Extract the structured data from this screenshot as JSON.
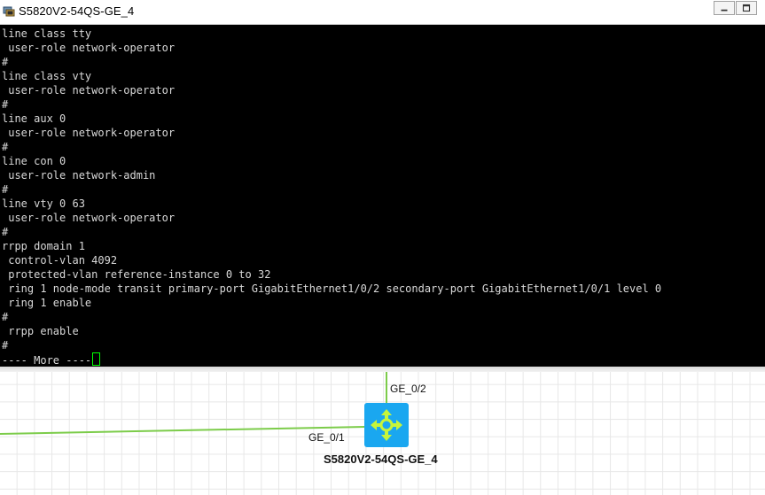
{
  "window": {
    "title": "S5820V2-54QS-GE_4",
    "icons": {
      "app": "terminal-app-icon",
      "minimize": "minimize-icon",
      "maximize": "maximize-icon"
    }
  },
  "terminal": {
    "lines": [
      "line class tty",
      " user-role network-operator",
      "#",
      "line class vty",
      " user-role network-operator",
      "#",
      "line aux 0",
      " user-role network-operator",
      "#",
      "line con 0",
      " user-role network-admin",
      "#",
      "line vty 0 63",
      " user-role network-operator",
      "#",
      "rrpp domain 1",
      " control-vlan 4092",
      " protected-vlan reference-instance 0 to 32",
      " ring 1 node-mode transit primary-port GigabitEthernet1/0/2 secondary-port GigabitEthernet1/0/1 level 0",
      " ring 1 enable",
      "#",
      " rrpp enable",
      "#"
    ],
    "prompt": "---- More ----",
    "colors": {
      "background": "#000000",
      "text": "#d9d9d9",
      "cursor": "#00ff00"
    }
  },
  "topology": {
    "device": {
      "name": "S5820V2-54QS-GE_4",
      "icon": "switch-icon",
      "color": "#1aa7f0"
    },
    "ports": {
      "top": "GE_0/2",
      "left": "GE_0/1"
    },
    "link_color": "#7ccc4a"
  }
}
